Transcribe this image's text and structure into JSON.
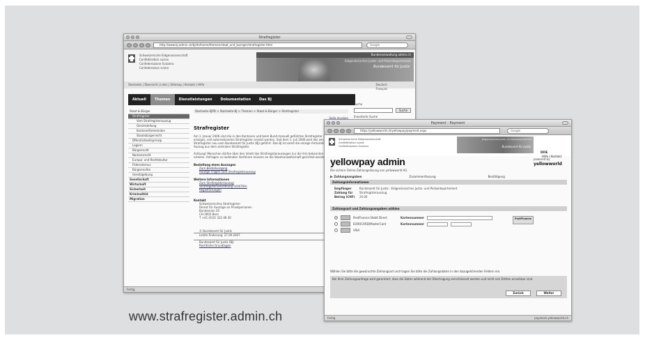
{
  "site_url": "www.strafregister.admin.ch",
  "win1": {
    "title": "Strafregister",
    "address": "http://www.bj.admin.ch/bj/de/home/themen/staat_und_buerger/strafregister.html",
    "search_placeholder": "Google",
    "agency": [
      "Schweizerische Eidgenossenschaft",
      "Confédération suisse",
      "Confederazione Svizzera",
      "Confederaziun svizra"
    ],
    "banner_head": "Bundesverwaltung admin.ch",
    "banner_sub": "Eidgenössisches Justiz- und Polizeidepartement",
    "banner_title": "Bundesamt für Justiz",
    "crumb_top": "Startseite | Übersicht | Links | Sitemap | Kontakt | Hilfe",
    "langs": [
      "Deutsch",
      "Français",
      "Italiano",
      "English"
    ],
    "nav": [
      "Aktuell",
      "Themen",
      "Dienstleistungen",
      "Dokumentation",
      "Das BJ"
    ],
    "search_label": "Suche",
    "search_button": "Suche",
    "search_advanced": "Erweiterte Suche",
    "sidebar": [
      {
        "label": "Staat & Bürger",
        "level": 0
      },
      {
        "label": "Strafregister",
        "level": 1,
        "active": true
      },
      {
        "label": "Vom Strafregisterauszug",
        "level": 2
      },
      {
        "label": "Gleichstellung",
        "level": 2
      },
      {
        "label": "Kantone/Gemeinden",
        "level": 2
      },
      {
        "label": "Staatsbürgerrecht",
        "level": 2
      },
      {
        "label": "Öffentlichkeitsprinzip",
        "level": 1
      },
      {
        "label": "Logiern",
        "level": 1
      },
      {
        "label": "Bürgerrecht",
        "level": 1
      },
      {
        "label": "Namensrecht",
        "level": 1
      },
      {
        "label": "Europa- und Rechtskultur",
        "level": 1
      },
      {
        "label": "Föderalismus",
        "level": 1
      },
      {
        "label": "Bürgerrechte",
        "level": 1
      },
      {
        "label": "Gesetzgebung",
        "level": 1
      },
      {
        "label": "Gesellschaft",
        "level": 0,
        "bold": true
      },
      {
        "label": "Wirtschaft",
        "level": 0,
        "bold": true
      },
      {
        "label": "Sicherheit",
        "level": 0,
        "bold": true
      },
      {
        "label": "Kriminalität",
        "level": 0,
        "bold": true
      },
      {
        "label": "Migration",
        "level": 0,
        "bold": true
      }
    ],
    "breadcrumb": "Startseite EJPD > Startseite BJ > Themen > Staat & Bürger > Strafregister",
    "top_link": "Seite drucken",
    "heading": "Strafregister",
    "para1": "Am 1. Januar 2006 sind die in den Kantonen und beim Bund manuell geführten Strafregister durch ein einziges, voll automatisiertes Strafregister ersetzt worden. Seit dem 1. Juli 2006 wird das zentrale Strafregister neu vom Bundesamt für Justiz (BJ) geführt. Das BJ ist somit die einzige Amtsstelle für einen Auszug aus dem zentralen Strafregister.",
    "para2": "Achtung! Menschen dürfen über den Inhalt des Strafregisterauszuges nur die ihm bekannten Auskünfte erteilen. Anfragen zu laufenden Verfahren müssen an die Staatsanwaltschaft gerichtet werden.",
    "order_heading": "Bestellung eines Auszuges",
    "order_links": [
      "Zum Bestellvorgang",
      "Häufige Fragen zum Strafregisterauszug"
    ],
    "more_heading": "Weitere Informationen",
    "more_links": [
      "Zum Strafregisterauszug",
      "Strafregisterverordnung (VOSTRA)",
      "Registrierungen"
    ],
    "contact_heading": "Kontakt",
    "contact_lines": [
      "Schweizerisches Strafregister",
      "Dienst für Auszüge an Privatpersonen",
      "Bundesrain 20",
      "CH-3003 Bern",
      "T +41 (0)31 322 48 30"
    ],
    "footer_lines": [
      "© Bundesamt für Justiz",
      "Letzte Änderung: 27.09.2007"
    ],
    "footer_sub": [
      "Bundesamt für Justiz (BJ)",
      "Rechtliche Grundlagen"
    ],
    "status": "Fertig"
  },
  "win2": {
    "title": "Payment - Payment",
    "address": "https://yellowworld.ch/yellowpay/payment.aspx",
    "search_placeholder": "Google",
    "agency": [
      "Schweizerische Eidgenossenschaft",
      "Confédération suisse",
      "Confederazione Svizzera"
    ],
    "banner_sub": "Eidgenössisches Justiz- und Polizeidepartement",
    "banner_title": "Bundesamt für Justiz",
    "langs": "DFIE",
    "contact": "Hilfe | Kontakt",
    "app_title": "yellowpay admin",
    "tagline": "Die sichere Online-Zahlungslösung von yellowworld AG",
    "powered_by": "powered by",
    "logo": "yellowworld",
    "steps": [
      "Zahlungsangaben",
      "Zusammenfassung",
      "Bestätigung"
    ],
    "sec1": "Zahlungsinformationen",
    "info": [
      {
        "k": "Empfänger",
        "v": "Bundesamt für Justiz - Eidgenössisches Justiz- und Polizeidepartement"
      },
      {
        "k": "Zahlung für",
        "v": "Strafregisterauszug"
      },
      {
        "k": "Betrag (CHF)",
        "v": "20.00"
      }
    ],
    "sec2": "Zahlungsart und Zahlungsangaben wählen",
    "methods": [
      {
        "name": "PostFinance Debit Direct",
        "field": "Kartennummer",
        "selected": true
      },
      {
        "name": "EUROCARD/MasterCard",
        "field": "Kartennummer",
        "selected": false
      },
      {
        "name": "VISA",
        "field": "",
        "selected": false
      }
    ],
    "pf_badge": "PostFinance",
    "note1": "Wählen Sie bitte die gewünschte Zahlungsart und tragen Sie bitte die Zahlungsdaten in den dazugehörenden Feldern ein.",
    "note2": "Bei Ihrer Zahlungsanfrage wird garantiert, dass die Daten während der Übertragung verschlüsselt werden und nicht von Dritten einsehbar sind.",
    "btn_back": "Zurück",
    "btn_next": "Weiter",
    "status": "Fertig",
    "status_right": "payment.yellowworld.ch"
  }
}
